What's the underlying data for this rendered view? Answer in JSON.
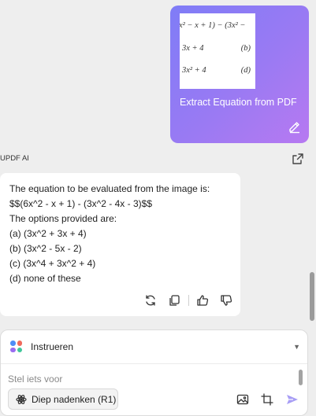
{
  "user_message": {
    "thumbnail_lines": [
      {
        "left": "x² − x + 1) − (3x² −",
        "right": ""
      },
      {
        "left": "3x + 4",
        "right": "(b)"
      },
      {
        "left": "3x² + 4",
        "right": "(d)"
      }
    ],
    "label": "Extract Equation from PDF",
    "edit_icon": "pencil-icon"
  },
  "assistant": {
    "name": "UPDF AI",
    "share_icon": "external-link-icon",
    "lines": [
      "The equation to be evaluated from the image is:",
      "$$(6x^2 - x + 1) - (3x^2 - 4x - 3)$$",
      "The options provided are:",
      "(a) (3x^2 + 3x + 4)",
      "(b) (3x^2 - 5x - 2)",
      "(c) (3x^4 + 3x^2 + 4)",
      "(d) none of these"
    ],
    "actions": [
      "regenerate-icon",
      "copy-icon",
      "thumbs-up-icon",
      "thumbs-down-icon"
    ]
  },
  "composer": {
    "mode_label": "Instrueren",
    "placeholder": "Stel iets voor",
    "think_label": "Diep nadenken (R1)",
    "tools": [
      "image-icon",
      "crop-icon",
      "send-icon"
    ]
  },
  "colors": {
    "bubble_start": "#7f7cf7",
    "bubble_end": "#b779f1",
    "send_icon": "#a79df5",
    "dot_blue": "#4f8df7",
    "dot_red": "#f06a5d",
    "dot_purple": "#9a6cf0",
    "dot_green": "#3fc69a"
  }
}
